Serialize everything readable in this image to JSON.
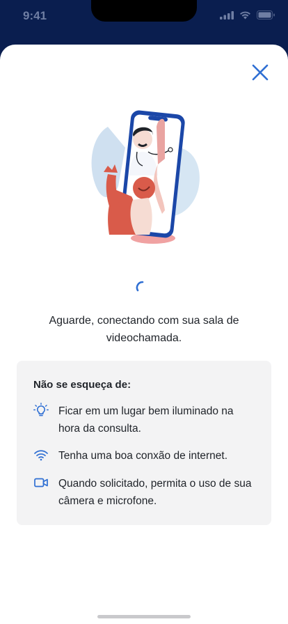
{
  "status_bar": {
    "time": "9:41"
  },
  "modal": {
    "close_icon": "close-icon",
    "illustration": "doctor-video-call-illustration",
    "loading": "spinner",
    "message": "Aguarde, conectando com sua sala de videochamada."
  },
  "tips": {
    "title": "Não se esqueça de:",
    "items": [
      {
        "icon": "lightbulb-icon",
        "text": "Ficar em um lugar bem iluminado na hora da consulta."
      },
      {
        "icon": "wifi-icon",
        "text": "Tenha uma boa conxão de internet."
      },
      {
        "icon": "video-camera-icon",
        "text": "Quando solicitado, permita o uso de sua câmera e microfone."
      }
    ]
  },
  "colors": {
    "accent": "#2f6fd3",
    "header_bg": "#0a1e4f",
    "card_bg": "#f3f3f4"
  }
}
